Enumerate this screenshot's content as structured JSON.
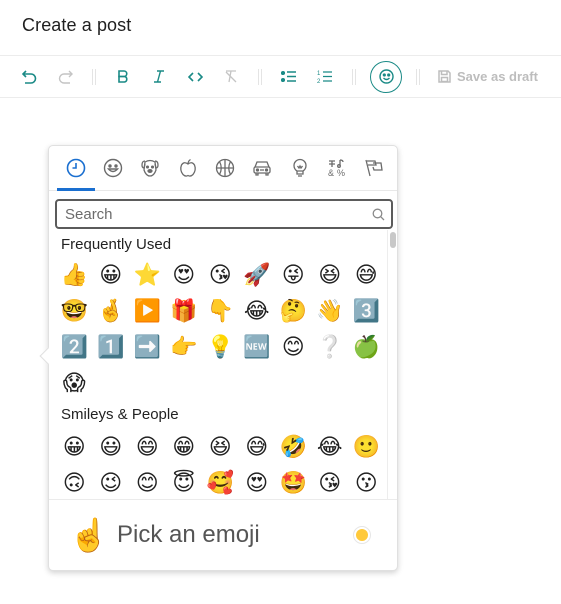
{
  "header": {
    "title": "Create a post"
  },
  "toolbar": {
    "buttons": [
      {
        "name": "undo",
        "icon": "undo-icon",
        "enabled": true
      },
      {
        "name": "redo",
        "icon": "redo-icon",
        "enabled": false
      },
      {
        "name": "bold",
        "icon": "bold-icon",
        "label": "B",
        "enabled": true
      },
      {
        "name": "italic",
        "icon": "italic-icon",
        "label": "I",
        "enabled": true
      },
      {
        "name": "code",
        "icon": "code-icon",
        "label": "<>",
        "enabled": true
      },
      {
        "name": "clear-format",
        "icon": "clear-format-icon",
        "enabled": false
      },
      {
        "name": "bullet-list",
        "icon": "bullet-list-icon",
        "enabled": true
      },
      {
        "name": "numbered-list",
        "icon": "numbered-list-icon",
        "enabled": true
      },
      {
        "name": "emoji",
        "icon": "smiley-icon",
        "enabled": true,
        "active": true
      }
    ],
    "save_draft_label": "Save as draft",
    "accent": "#1a8a86"
  },
  "picker": {
    "categories": [
      {
        "name": "Frequently Used",
        "icon": "clock-icon",
        "active": true
      },
      {
        "name": "Smileys & People",
        "icon": "smiley-icon"
      },
      {
        "name": "Animals & Nature",
        "icon": "dog-icon"
      },
      {
        "name": "Food & Drink",
        "icon": "apple-icon"
      },
      {
        "name": "Activity",
        "icon": "basketball-icon"
      },
      {
        "name": "Travel & Places",
        "icon": "car-icon"
      },
      {
        "name": "Objects",
        "icon": "lightbulb-icon"
      },
      {
        "name": "Symbols",
        "icon": "symbols-icon"
      },
      {
        "name": "Flags",
        "icon": "flags-icon"
      }
    ],
    "active_color": "#1a6fd0",
    "search": {
      "placeholder": "Search",
      "value": ""
    },
    "sections": [
      {
        "title": "Frequently Used",
        "emojis": [
          "👍",
          "😀",
          "⭐",
          "😍",
          "😘",
          "🚀",
          "😜",
          "😆",
          "😅",
          "🤓",
          "🤞",
          "▶️",
          "🎁",
          "👇",
          "😂",
          "🤔",
          "👋",
          "3️⃣",
          "2️⃣",
          "1️⃣",
          "➡️",
          "👉",
          "💡",
          "🆕",
          "😊",
          "❔",
          "🍏",
          "😱"
        ]
      },
      {
        "title": "Smileys & People",
        "emojis": [
          "😀",
          "😃",
          "😄",
          "😁",
          "😆",
          "😅",
          "🤣",
          "😂",
          "🙂",
          "🙃",
          "😉",
          "😊",
          "😇",
          "🥰",
          "😍",
          "🤩",
          "😘",
          "😗"
        ]
      }
    ],
    "preview": {
      "emoji": "☝️",
      "label": "Pick an emoji"
    },
    "skin_tone": {
      "color": "#ffc93a"
    }
  }
}
